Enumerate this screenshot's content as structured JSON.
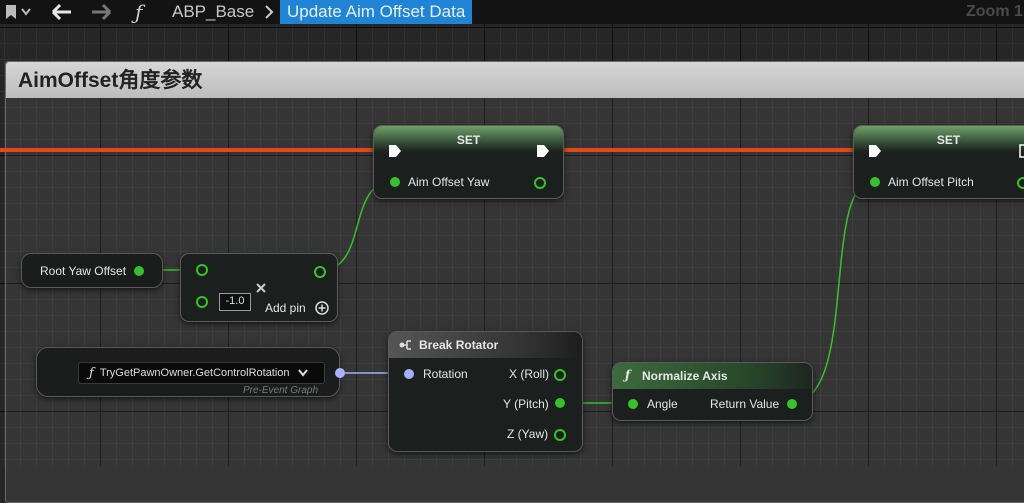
{
  "toolbar": {
    "breadcrumbs": [
      "ABP_Base",
      "Update Aim Offset Data"
    ],
    "zoom_label": "Zoom 1"
  },
  "comment": {
    "title": "AimOffset角度参数"
  },
  "nodes": {
    "set_yaw": {
      "title": "SET",
      "pin": "Aim Offset Yaw"
    },
    "set_pitch": {
      "title": "SET",
      "pin": "Aim Offset Pitch"
    },
    "root_yaw": {
      "label": "Root Yaw Offset"
    },
    "multiply": {
      "value": "-1.0",
      "add_pin": "Add pin"
    },
    "pawn_rotation": {
      "function": "TryGetPawnOwner.GetControlRotation",
      "source": "Pre-Event Graph"
    },
    "break_rotator": {
      "title": "Break Rotator",
      "input": "Rotation",
      "outputs": [
        "X (Roll)",
        "Y (Pitch)",
        "Z (Yaw)"
      ]
    },
    "normalize_axis": {
      "title": "Normalize Axis",
      "input": "Angle",
      "output": "Return Value"
    }
  },
  "colors": {
    "exec_wire": "#e04a1a",
    "float_wire": "#35c22a",
    "struct_wire": "#9fb0ff",
    "accent": "#1f84d6"
  }
}
